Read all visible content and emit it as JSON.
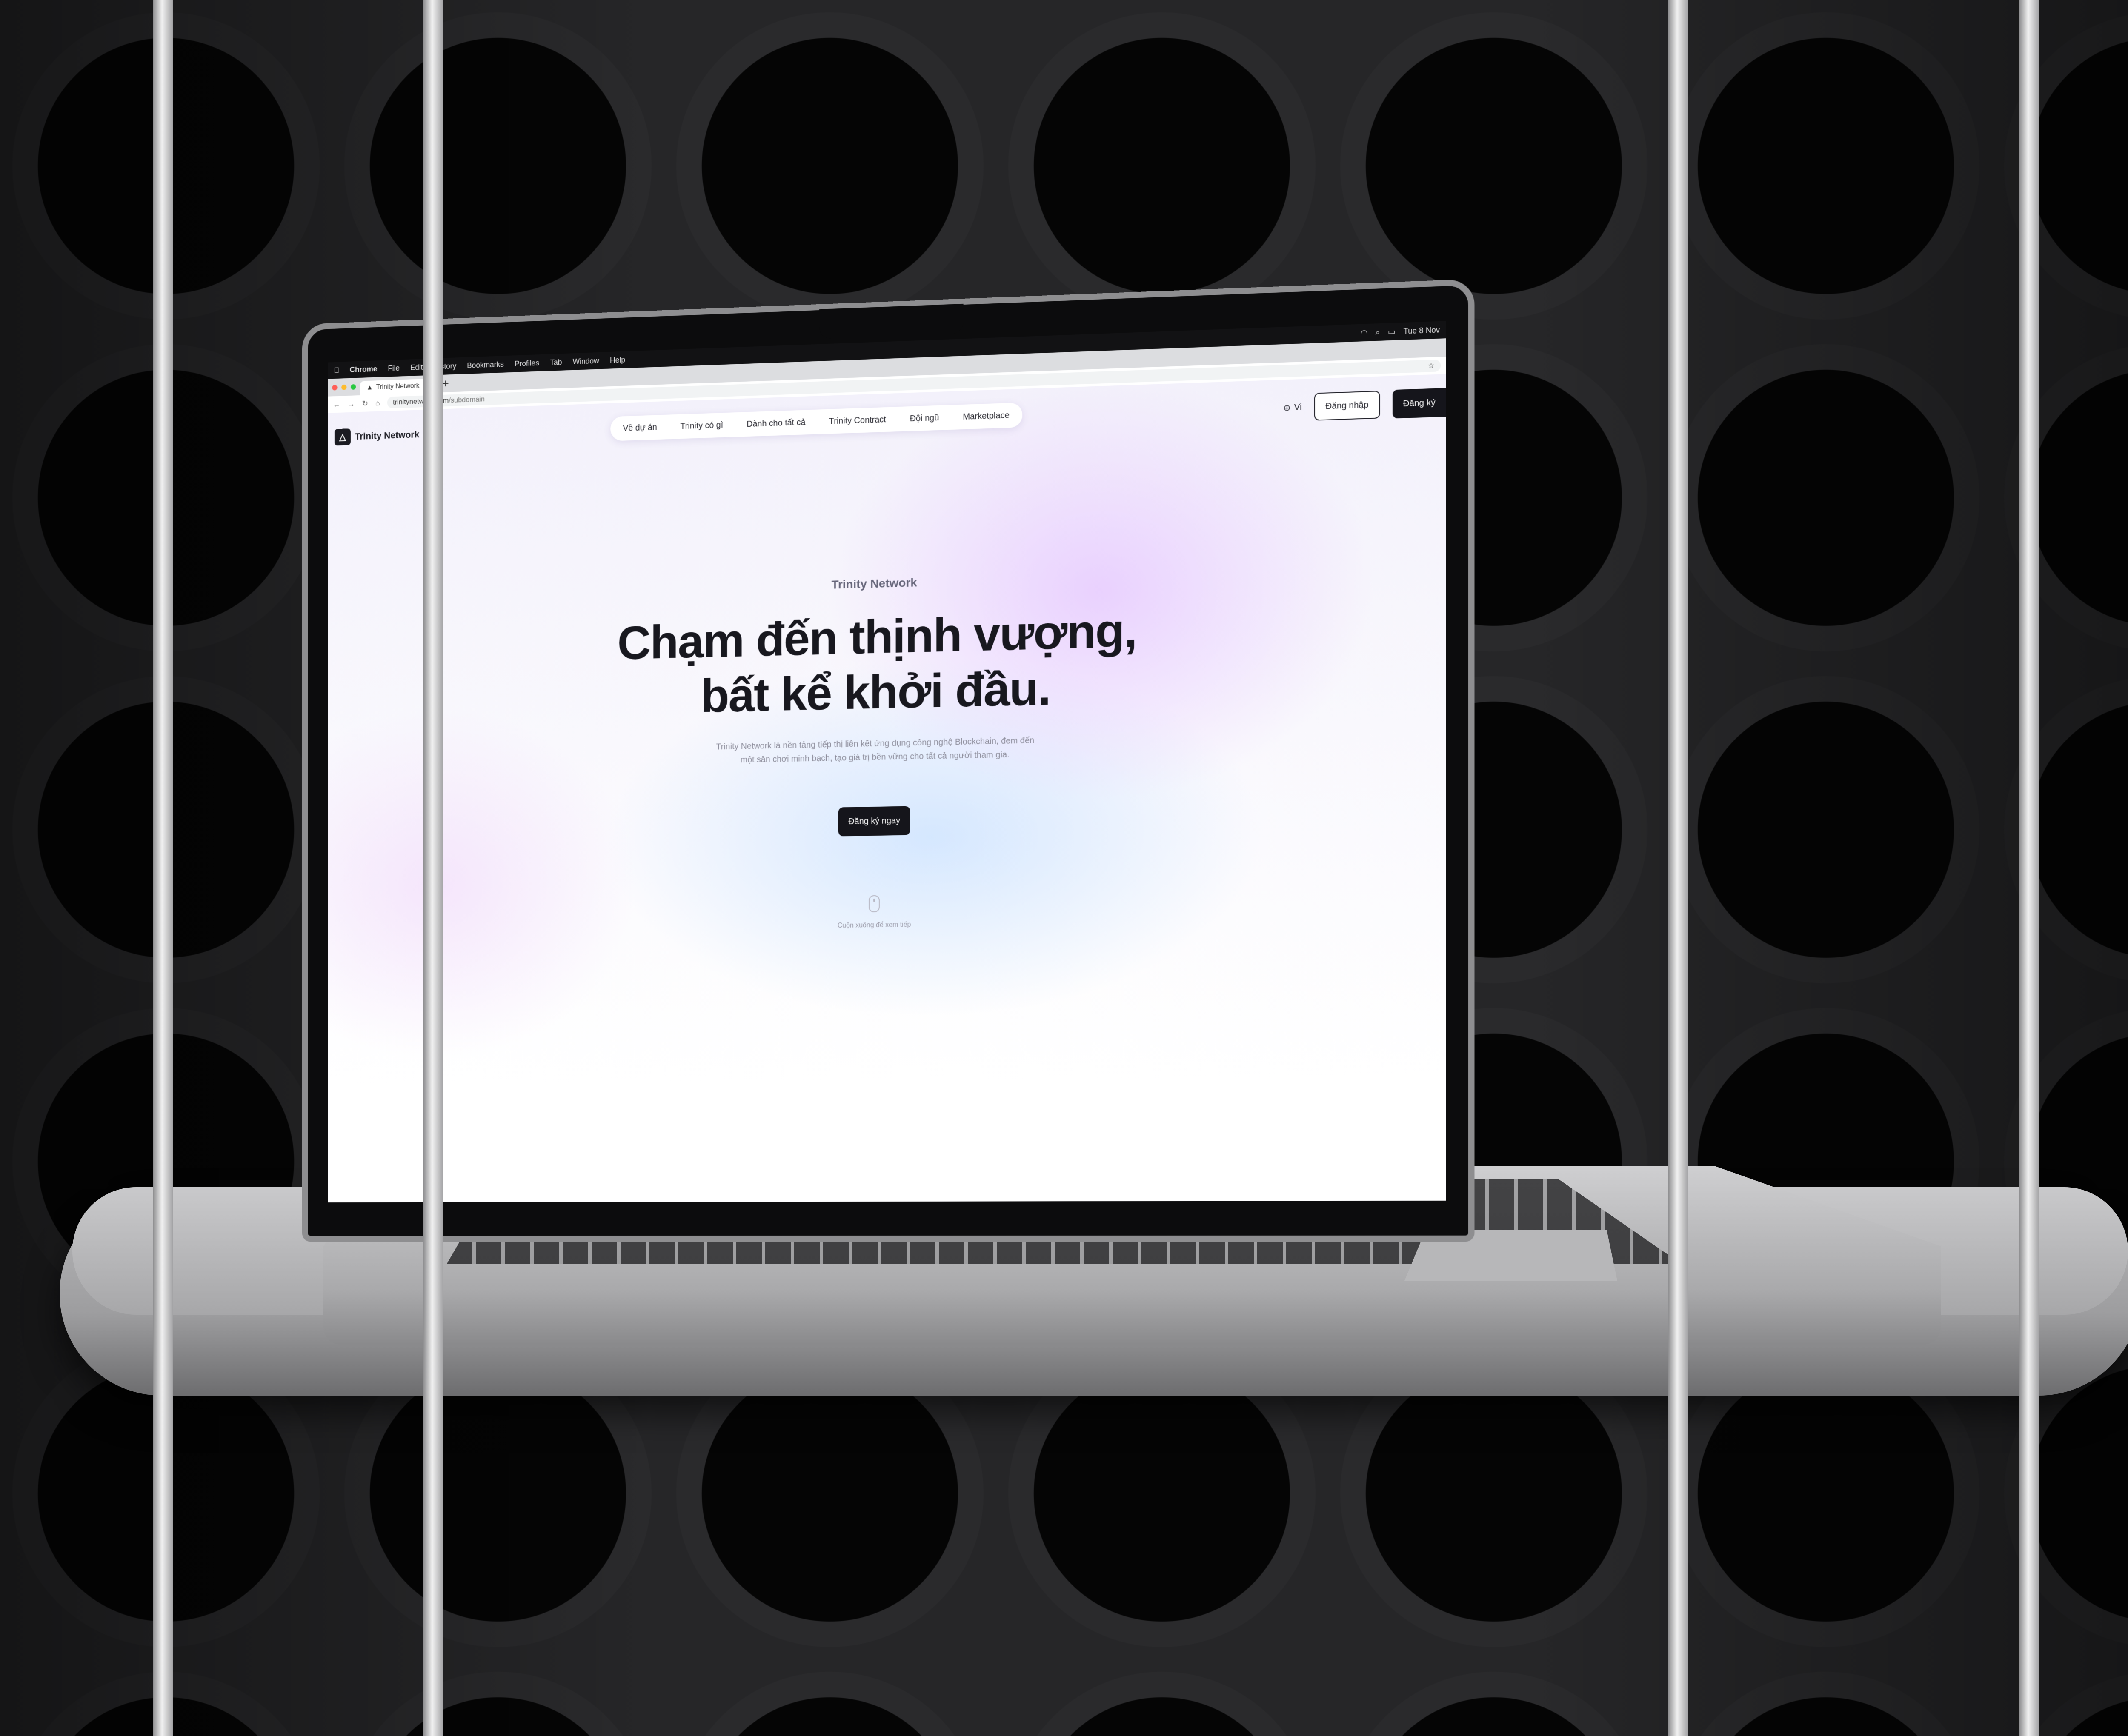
{
  "menubar": {
    "apple": "",
    "app": "Chrome",
    "items": [
      "File",
      "Edit",
      "History",
      "Bookmarks",
      "Profiles",
      "Tab",
      "Window",
      "Help"
    ],
    "clock": "Tue 8 Nov"
  },
  "browser": {
    "tab_title": "Trinity Network",
    "new_tab": "+",
    "url_host": "trinitynetwork.com",
    "url_path": "/subdomain",
    "back": "←",
    "forward": "→",
    "reload": "↻",
    "home": "⌂",
    "star": "☆"
  },
  "site": {
    "brand": "Trinity Network",
    "nav": [
      "Về dự án",
      "Trinity có gì",
      "Dành cho tất cả",
      "Trinity Contract",
      "Đội ngũ",
      "Marketplace"
    ],
    "language": "Vi",
    "login": "Đăng nhập",
    "signup": "Đăng ký",
    "eyebrow": "Trinity Network",
    "headline_line1": "Chạm đến thịnh vượng,",
    "headline_line2": "bất kể khởi đầu.",
    "description": "Trinity Network là nền tảng tiếp thị liên kết ứng dụng công nghệ Blockchain, đem đến một sân chơi minh bạch, tạo giá trị bền vững cho tất cả người tham gia.",
    "cta": "Đăng ký ngay",
    "scroll_hint": "Cuộn xuống để xem tiếp"
  },
  "colors": {
    "accent_dark": "#15151b",
    "traffic_red": "#ff5f57",
    "traffic_yellow": "#febc2e",
    "traffic_green": "#28c840"
  }
}
